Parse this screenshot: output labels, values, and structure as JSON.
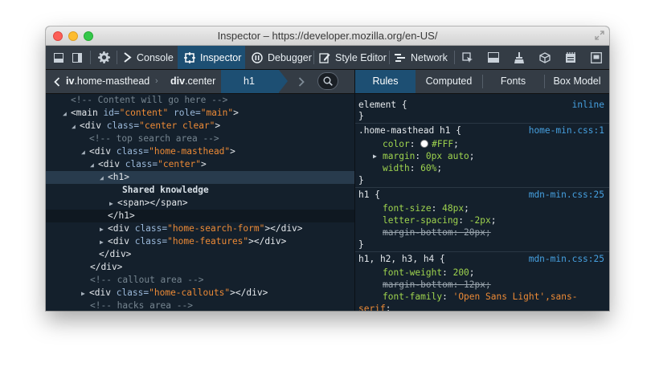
{
  "window": {
    "title": "Inspector – https://developer.mozilla.org/en-US/"
  },
  "toolbar": {
    "tabs": [
      {
        "label": "Console",
        "icon": "console-icon"
      },
      {
        "label": "Inspector",
        "icon": "inspector-icon",
        "active": true
      },
      {
        "label": "Debugger",
        "icon": "debugger-icon"
      },
      {
        "label": "Style Editor",
        "icon": "style-editor-icon"
      },
      {
        "label": "Network",
        "icon": "network-icon"
      }
    ]
  },
  "breadcrumbs": [
    {
      "tag": "iv",
      "cls": ".home-masthead"
    },
    {
      "tag": "div",
      "cls": ".center"
    },
    {
      "tag": "h1",
      "cls": "",
      "active": true
    }
  ],
  "markup": {
    "r0": "<!-- Content will go here -->",
    "r1_tag": "<main",
    "r1_a1": "id=",
    "r1_v1": "\"content\"",
    "r1_a2": "role=",
    "r1_v2": "\"main\"",
    "r1_end": ">",
    "r2_tag": "<div",
    "r2_a1": "class=",
    "r2_v1": "\"center clear\"",
    "r2_end": ">",
    "r3": "<!-- top search area -->",
    "r4_tag": "<div",
    "r4_a1": "class=",
    "r4_v1": "\"home-masthead\"",
    "r4_end": ">",
    "r5_tag": "<div",
    "r5_a1": "class=",
    "r5_v1": "\"center\"",
    "r5_end": ">",
    "r6": "<h1>",
    "r7": "Shared knowledge",
    "r8": "<span></span>",
    "r9": "</h1>",
    "r10_tag": "<div",
    "r10_a1": "class=",
    "r10_v1": "\"home-search-form\"",
    "r10_end": "></div>",
    "r11_tag": "<div",
    "r11_a1": "class=",
    "r11_v1": "\"home-features\"",
    "r11_end": "></div>",
    "r12": "</div>",
    "r13": "</div>",
    "r14": "<!-- callout area -->",
    "r15_tag": "<div",
    "r15_a1": "class=",
    "r15_v1": "\"home-callouts\"",
    "r15_end": "></div>",
    "r16": "<!-- hacks area -->"
  },
  "sidebar_tabs": [
    "Rules",
    "Computed",
    "Fonts",
    "Box Model"
  ],
  "rules": {
    "r1_sel": "element {",
    "r1_src": "inline",
    "r1_close": "}",
    "r2_sel": ".home-masthead h1 {",
    "r2_src": "home-min.css:1",
    "r2_p1": "color",
    "r2_v1": "#FFF",
    "r2_p2": "margin",
    "r2_v2": "0px auto",
    "r2_p3": "width",
    "r2_v3": "60%",
    "r2_close": "}",
    "r3_sel": "h1 {",
    "r3_src": "mdn-min.css:25",
    "r3_p1": "font-size",
    "r3_v1": "48px",
    "r3_p2": "letter-spacing",
    "r3_v2": "-2px",
    "r3_p3": "margin-bottom",
    "r3_v3": "20px",
    "r3_close": "}",
    "r4_sel": "h1, h2, h3, h4 {",
    "r4_src": "mdn-min.css:25",
    "r4_p1": "font-weight",
    "r4_v1": "200",
    "r4_p2": "margin-bottom",
    "r4_v2": "12px",
    "r4_p3": "font-family",
    "r4_v3a": "'Open Sans Light',sans-",
    "r4_v3b": "serif"
  }
}
